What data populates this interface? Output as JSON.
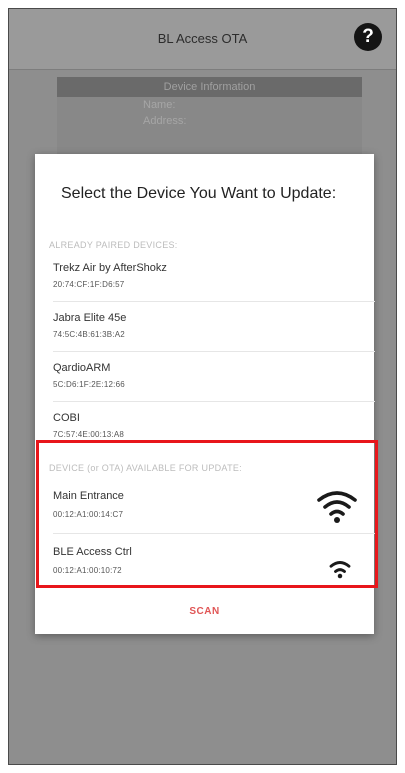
{
  "appbar": {
    "title": "BL Access OTA",
    "help_icon": "question-circle-icon",
    "help_glyph": "?"
  },
  "info_panel": {
    "header": "Device Information",
    "rows": [
      "Name:",
      "Address:"
    ]
  },
  "dialog": {
    "title": "Select the Device You Want to Update:",
    "paired_header": "ALREADY PAIRED DEVICES:",
    "paired_devices": [
      {
        "name": "Trekz Air by AfterShokz",
        "address": "20:74:CF:1F:D6:57"
      },
      {
        "name": "Jabra Elite 45e",
        "address": "74:5C:4B:61:3B:A2"
      },
      {
        "name": "QardioARM",
        "address": "5C:D6:1F:2E:12:66"
      },
      {
        "name": "COBI",
        "address": "7C:57:4E:00:13:A8"
      }
    ],
    "ota_header": "DEVICE (or OTA) AVAILABLE FOR UPDATE:",
    "ota_devices": [
      {
        "name": "Main Entrance",
        "address": "00:12:A1:00:14:C7",
        "signal_icon": "wifi-signal-icon"
      },
      {
        "name": "BLE Access Ctrl",
        "address": "00:12:A1:00:10:72",
        "signal_icon": "wifi-signal-icon"
      }
    ],
    "scan_label": "SCAN"
  },
  "colors": {
    "highlight": "#e8161b",
    "scan": "#e05555",
    "overlay": "#8e8e8e"
  }
}
